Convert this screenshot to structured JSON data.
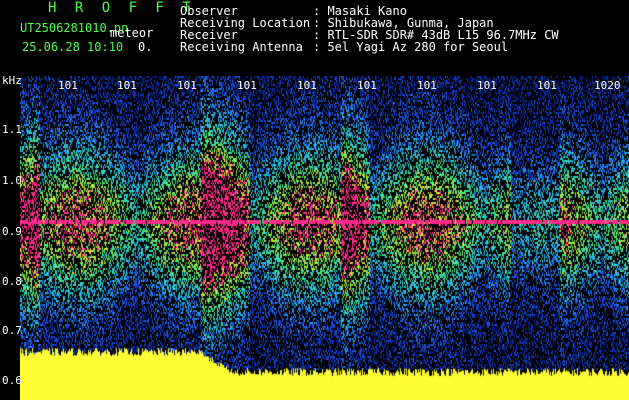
{
  "header": {
    "title": "H R O F F T",
    "filename": "UT2506281010.pn",
    "filename_suffix": "meteor",
    "timestamp": "25.06.28 10:10",
    "timestamp_value": "0.",
    "rows": [
      {
        "label": "Observer",
        "value": ": Masaki Kano"
      },
      {
        "label": "Receiving Location",
        "value": ": Shibukawa, Gunma, Japan"
      },
      {
        "label": "Receiver",
        "value": ": RTL-SDR SDR# 43dB L15 96.7MHz CW"
      },
      {
        "label": "Receiving Antenna",
        "value": ": 5el Yagi Az 280 for Seoul"
      }
    ]
  },
  "axis": {
    "y_unit": "kHz",
    "y_ticks": [
      "1.1",
      "1.0",
      "0.9",
      "0.8",
      "0.7",
      "0.6"
    ],
    "x_ticks": [
      "101",
      "101",
      "101",
      "101",
      "101",
      "101",
      "101",
      "101",
      "101",
      "1020"
    ]
  },
  "colors": {
    "background": "#000000",
    "text": "#ffffff",
    "title": "#4cff4c",
    "trace": "#ffff33",
    "signal": "#ff2a8a"
  }
}
